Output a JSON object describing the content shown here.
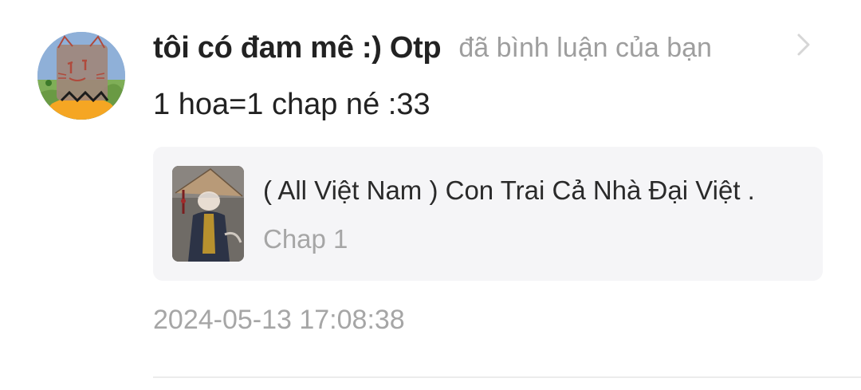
{
  "notification": {
    "user": {
      "name": "tôi có đam mê :) Otp",
      "avatar_icon": "cat-drawing-avatar"
    },
    "action": "đã bình luận của bạn",
    "chevron_icon": "chevron-right-icon",
    "comment": "1 hoa=1 chap né :33",
    "story": {
      "title": "( All Việt Nam ) Con Trai Cả Nhà Đại Việt .",
      "chapter": "Chap 1",
      "cover_icon": "story-cover-image"
    },
    "timestamp": "2024-05-13 17:08:38"
  },
  "colors": {
    "username": "#222222",
    "secondary_text": "#9e9e9e",
    "card_background": "#f5f5f7",
    "divider": "#ececec"
  }
}
